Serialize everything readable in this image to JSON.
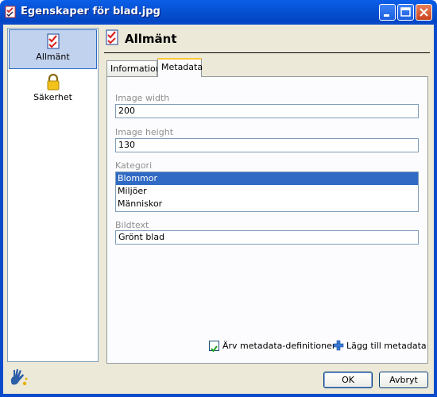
{
  "window": {
    "title": "Egenskaper för blad.jpg"
  },
  "sidebar": {
    "items": [
      {
        "label": "Allmänt",
        "icon": "checklist-icon",
        "selected": true
      },
      {
        "label": "Säkerhet",
        "icon": "lock-icon",
        "selected": false
      }
    ]
  },
  "header": {
    "title": "Allmänt"
  },
  "tabs": [
    {
      "label": "Information",
      "active": false
    },
    {
      "label": "Metadata",
      "active": true
    }
  ],
  "metadata": {
    "image_width": {
      "label": "Image width",
      "value": "200"
    },
    "image_height": {
      "label": "Image height",
      "value": "130"
    },
    "category": {
      "label": "Kategori",
      "options": [
        "Blommor",
        "Miljöer",
        "Människor"
      ],
      "selected": "Blommor"
    },
    "caption": {
      "label": "Bildtext",
      "value": "Grönt blad"
    }
  },
  "footer": {
    "inherit_label": "Ärv metadata-definitioner",
    "inherit_checked": true,
    "add_label": "Lägg till metadata"
  },
  "buttons": {
    "ok": "OK",
    "cancel": "Avbryt"
  },
  "colors": {
    "titlebar": "#0a5ee8",
    "selection": "#316ac5",
    "nav_selected": "#c1d2ee",
    "accent_tab": "#ffc83c"
  }
}
